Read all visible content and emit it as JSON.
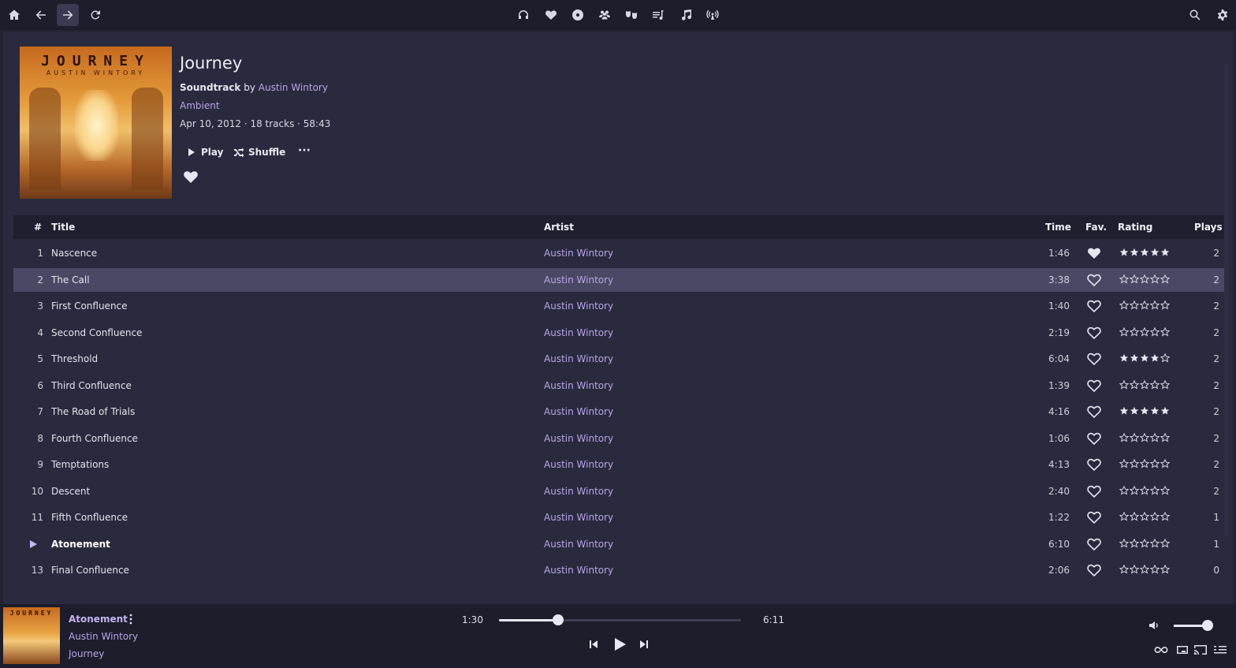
{
  "colors": {
    "background": "#222232",
    "topbar": "#1d1d2c",
    "content": "#2a2a3e",
    "accent_text": "#b9a6e8",
    "selected_row": "#4a4864"
  },
  "topbar": {
    "left_icons": [
      "home-icon",
      "arrow-left-icon",
      "arrow-right-icon",
      "refresh-icon"
    ],
    "center_icons": [
      "headphones-icon",
      "heart-icon",
      "disc-icon",
      "users-icon",
      "masks-icon",
      "playlist-icon",
      "music-note-icon",
      "broadcast-icon"
    ],
    "right_icons": [
      "search-icon",
      "gear-icon"
    ]
  },
  "album": {
    "cover_word": "JOURNEY",
    "cover_sub": "AUSTIN WINTORY",
    "title": "Journey",
    "type": "Soundtrack",
    "by": "by",
    "artist": "Austin Wintory",
    "genre": "Ambient",
    "meta": "Apr 10, 2012 · 18 tracks · 58:43",
    "play_label": "Play",
    "shuffle_label": "Shuffle",
    "more_label": "···"
  },
  "table": {
    "headers": {
      "num": "#",
      "title": "Title",
      "artist": "Artist",
      "time": "Time",
      "fav": "Fav.",
      "rating": "Rating",
      "plays": "Plays"
    },
    "rows": [
      {
        "num": "1",
        "title": "Nascence",
        "artist": "Austin Wintory",
        "time": "1:46",
        "fav": true,
        "rating": 5,
        "plays": "2"
      },
      {
        "num": "2",
        "title": "The Call",
        "artist": "Austin Wintory",
        "time": "3:38",
        "fav": false,
        "rating": 0,
        "plays": "2",
        "selected": true
      },
      {
        "num": "3",
        "title": "First Confluence",
        "artist": "Austin Wintory",
        "time": "1:40",
        "fav": false,
        "rating": 0,
        "plays": "2"
      },
      {
        "num": "4",
        "title": "Second Confluence",
        "artist": "Austin Wintory",
        "time": "2:19",
        "fav": false,
        "rating": 0,
        "plays": "2"
      },
      {
        "num": "5",
        "title": "Threshold",
        "artist": "Austin Wintory",
        "time": "6:04",
        "fav": false,
        "rating": 4,
        "plays": "2"
      },
      {
        "num": "6",
        "title": "Third Confluence",
        "artist": "Austin Wintory",
        "time": "1:39",
        "fav": false,
        "rating": 0,
        "plays": "2"
      },
      {
        "num": "7",
        "title": "The Road of Trials",
        "artist": "Austin Wintory",
        "time": "4:16",
        "fav": false,
        "rating": 5,
        "plays": "2"
      },
      {
        "num": "8",
        "title": "Fourth Confluence",
        "artist": "Austin Wintory",
        "time": "1:06",
        "fav": false,
        "rating": 0,
        "plays": "2"
      },
      {
        "num": "9",
        "title": "Temptations",
        "artist": "Austin Wintory",
        "time": "4:13",
        "fav": false,
        "rating": 0,
        "plays": "2"
      },
      {
        "num": "10",
        "title": "Descent",
        "artist": "Austin Wintory",
        "time": "2:40",
        "fav": false,
        "rating": 0,
        "plays": "2"
      },
      {
        "num": "11",
        "title": "Fifth Confluence",
        "artist": "Austin Wintory",
        "time": "1:22",
        "fav": false,
        "rating": 0,
        "plays": "1"
      },
      {
        "num": "",
        "title": "Atonement",
        "artist": "Austin Wintory",
        "time": "6:10",
        "fav": false,
        "rating": 0,
        "plays": "1",
        "current": true
      },
      {
        "num": "13",
        "title": "Final Confluence",
        "artist": "Austin Wintory",
        "time": "2:06",
        "fav": false,
        "rating": 0,
        "plays": "0"
      }
    ]
  },
  "player": {
    "cover_word": "JOURNEY",
    "title": "Atonement",
    "artist": "Austin Wintory",
    "album": "Journey",
    "current_time": "1:30",
    "total_time": "6:11",
    "progress": 0.243,
    "volume": 0.85
  }
}
